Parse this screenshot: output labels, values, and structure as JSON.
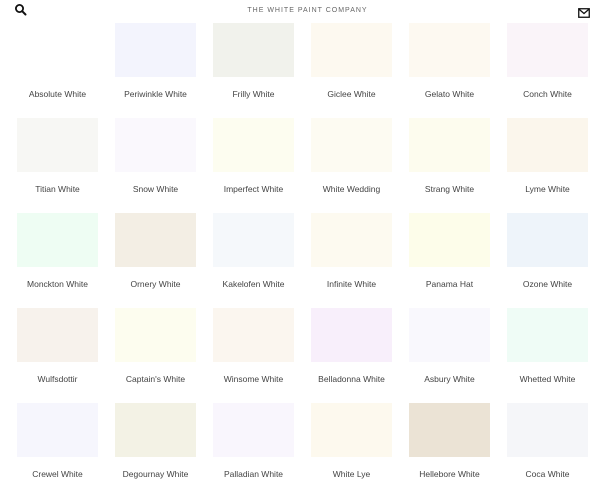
{
  "header": {
    "brand": "THE WHITE PAINT COMPANY",
    "search_icon": "search-icon",
    "mail_icon": "envelope-icon"
  },
  "paints": [
    {
      "name": "Absolute White",
      "color": "#ffffff"
    },
    {
      "name": "Periwinkle White",
      "color": "#f3f4fd"
    },
    {
      "name": "Frilly White",
      "color": "#f1f2ec"
    },
    {
      "name": "Giclee White",
      "color": "#fdf9f0"
    },
    {
      "name": "Gelato White",
      "color": "#fdf9f1"
    },
    {
      "name": "Conch White",
      "color": "#faf4f9"
    },
    {
      "name": "Titian White",
      "color": "#f7f7f4"
    },
    {
      "name": "Snow White",
      "color": "#faf8fd"
    },
    {
      "name": "Imperfect White",
      "color": "#fdfdf0"
    },
    {
      "name": "White Wedding",
      "color": "#fdfbf2"
    },
    {
      "name": "Strang White",
      "color": "#fdfcee"
    },
    {
      "name": "Lyme White",
      "color": "#fbf6ec"
    },
    {
      "name": "Monckton White",
      "color": "#eefdf3"
    },
    {
      "name": "Ornery White",
      "color": "#f3eee4"
    },
    {
      "name": "Kakelofen White",
      "color": "#f5f8fb"
    },
    {
      "name": "Infinite White",
      "color": "#fdfaf0"
    },
    {
      "name": "Panama Hat",
      "color": "#fdfdea"
    },
    {
      "name": "Ozone White",
      "color": "#eef4fa"
    },
    {
      "name": "Wulfsdottir",
      "color": "#f7f2ec"
    },
    {
      "name": "Captain's White",
      "color": "#fdfdef"
    },
    {
      "name": "Winsome White",
      "color": "#fbf6ef"
    },
    {
      "name": "Belladonna White",
      "color": "#f8effb"
    },
    {
      "name": "Asbury White",
      "color": "#f9f8fd"
    },
    {
      "name": "Whetted White",
      "color": "#effcf6"
    },
    {
      "name": "Crewel White",
      "color": "#f6f6fd"
    },
    {
      "name": "Degournay White",
      "color": "#f3f2e5"
    },
    {
      "name": "Palladian White",
      "color": "#f9f6fd"
    },
    {
      "name": "White Lye",
      "color": "#fdf9ee"
    },
    {
      "name": "Hellebore White",
      "color": "#ebe3d5"
    },
    {
      "name": "Coca White",
      "color": "#f5f6f9"
    }
  ]
}
